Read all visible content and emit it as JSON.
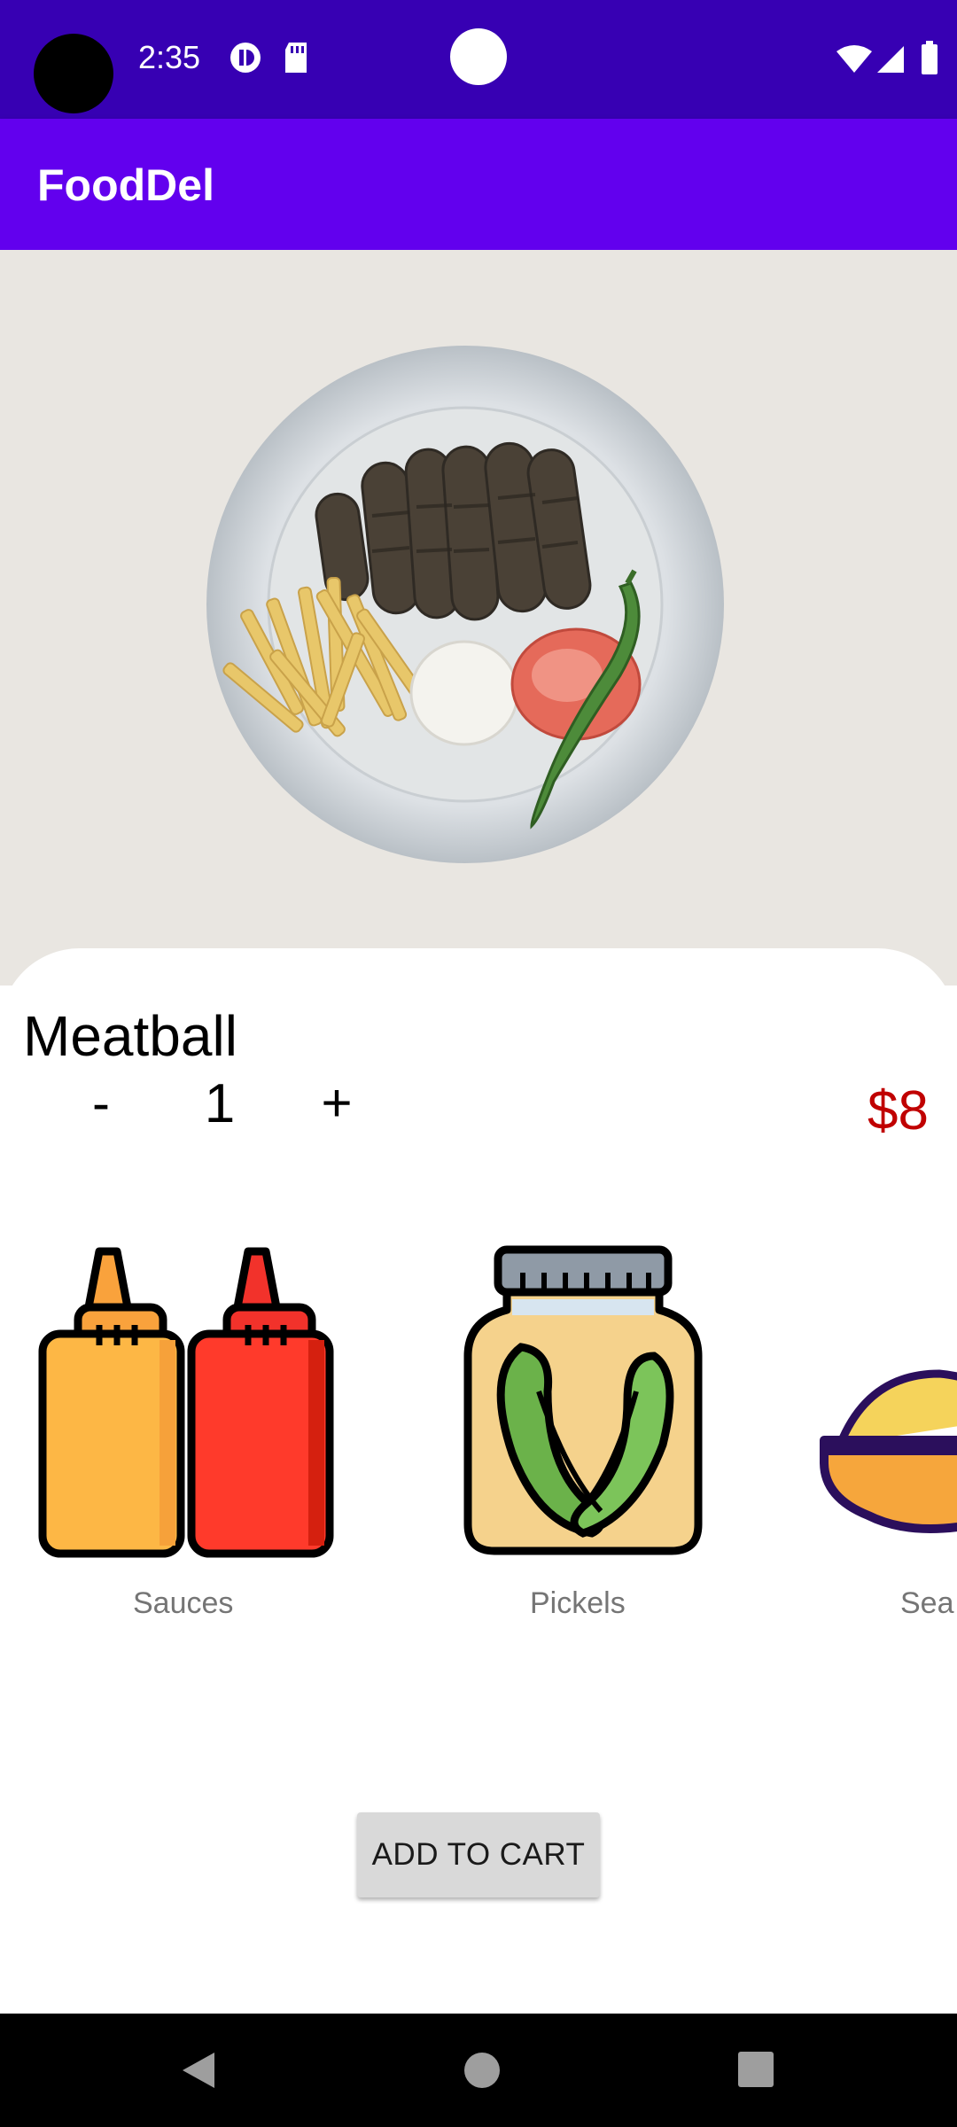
{
  "status_bar": {
    "time": "2:35",
    "icons": [
      "camera-dot",
      "sync-icon",
      "sd-card-icon",
      "wifi-icon",
      "signal-icon",
      "battery-icon"
    ]
  },
  "app_bar": {
    "title": "FoodDel"
  },
  "hero": {
    "image": "meatball-plate-photo"
  },
  "item": {
    "name": "Meatball",
    "quantity": "1",
    "minus_label": "-",
    "plus_label": "+",
    "price": "$8"
  },
  "addons": [
    {
      "label": "Sauces",
      "icon": "sauce-bottles-icon"
    },
    {
      "label": "Pickels",
      "icon": "pickle-jar-icon"
    },
    {
      "label": "Sea",
      "icon": "seasoning-bowl-icon"
    }
  ],
  "cart": {
    "add_label": "ADD TO CART"
  },
  "nav": {
    "items": [
      "back-icon",
      "home-icon",
      "recents-icon"
    ]
  },
  "colors": {
    "status_bar": "#3700B3",
    "app_bar": "#6200EE",
    "price": "#C00000",
    "hero_bg": "#E9E6E1"
  }
}
